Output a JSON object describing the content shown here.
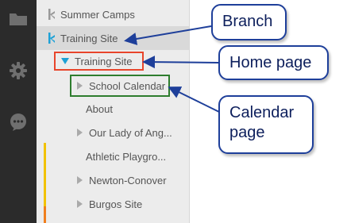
{
  "tree": {
    "items": [
      {
        "label": "Summer Camps"
      },
      {
        "label": "Training Site"
      },
      {
        "label": "Training Site"
      },
      {
        "label": "School Calendar"
      },
      {
        "label": "About"
      },
      {
        "label": "Our Lady of Ang..."
      },
      {
        "label": "Athletic Playgro..."
      },
      {
        "label": "Newton-Conover"
      },
      {
        "label": "Burgos Site"
      }
    ]
  },
  "sidebar_icons": [
    "folder-icon",
    "gear-icon",
    "chat-bubble-icon"
  ],
  "callouts": {
    "branch": "Branch",
    "home_page": "Home page",
    "calendar_line1": "Calendar",
    "calendar_line2": "page"
  },
  "colors": {
    "callout_border": "#1e3f9a",
    "home_box": "#e8452b",
    "calendar_box": "#2e7d2e",
    "expand_triangle": "#1da1d6"
  }
}
